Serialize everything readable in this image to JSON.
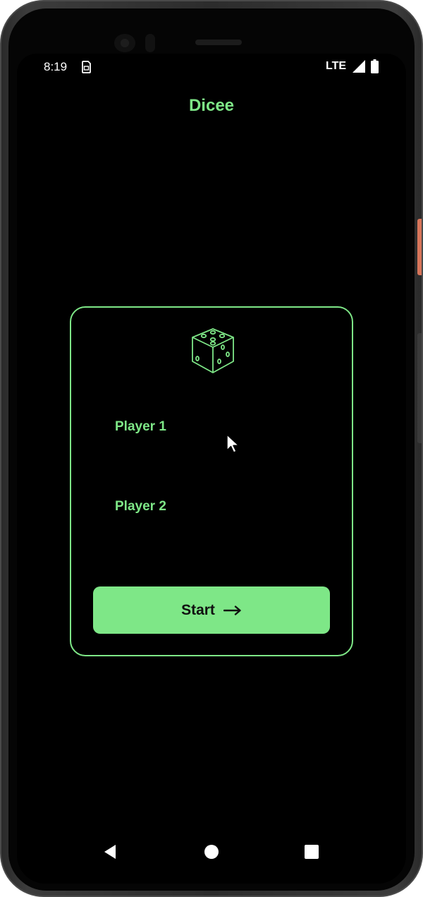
{
  "status_bar": {
    "time": "8:19",
    "network": "LTE",
    "icons": [
      "sim-card-icon",
      "signal-icon",
      "battery-icon"
    ]
  },
  "app": {
    "title": "Dicee",
    "accent_color": "#7ee787",
    "background_color": "#000000"
  },
  "card": {
    "icon": "dice-icon",
    "player1": {
      "label": "Player 1",
      "value": ""
    },
    "player2": {
      "label": "Player 2",
      "value": ""
    },
    "start_button": {
      "label": "Start",
      "icon": "arrow-right-icon"
    }
  },
  "nav_bar": {
    "buttons": [
      "back-icon",
      "home-icon",
      "recents-icon"
    ]
  }
}
